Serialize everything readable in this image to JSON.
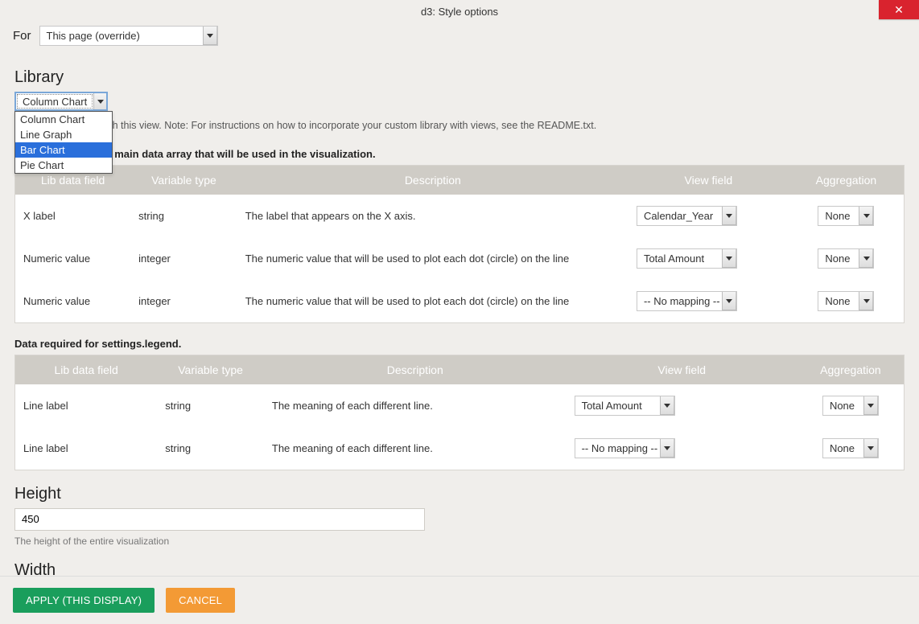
{
  "window_title": "d3: Style options",
  "for": {
    "label": "For",
    "value": "This page (override)"
  },
  "library": {
    "section_label": "Library",
    "selected": "Column Chart",
    "options": [
      "Column Chart",
      "Line Graph",
      "Bar Chart",
      "Pie Chart"
    ],
    "highlighted_option_index": 2,
    "visible_help_fragment": "u would like to use with this view. Note: For instructions on how to incorporate your custom library with views, see the README.txt."
  },
  "rows_section": {
    "visible_heading_fragment": "gs.rows. This is the main data array that will be used in the visualization.",
    "headers": [
      "Lib data field",
      "Variable type",
      "Description",
      "View field",
      "Aggregation"
    ],
    "rows": [
      {
        "lib": "X label",
        "vartype": "string",
        "desc": "The label that appears on the X axis.",
        "view": "Calendar_Year",
        "agg": "None"
      },
      {
        "lib": "Numeric value",
        "vartype": "integer",
        "desc": "The numeric value that will be used to plot each dot (circle) on the line",
        "view": "Total Amount",
        "agg": "None"
      },
      {
        "lib": "Numeric value",
        "vartype": "integer",
        "desc": "The numeric value that will be used to plot each dot (circle) on the line",
        "view": "-- No mapping --",
        "agg": "None"
      }
    ]
  },
  "legend_section": {
    "heading": "Data required for settings.legend.",
    "headers": [
      "Lib data field",
      "Variable type",
      "Description",
      "View field",
      "Aggregation"
    ],
    "rows": [
      {
        "lib": "Line label",
        "vartype": "string",
        "desc": "The meaning of each different line.",
        "view": "Total Amount",
        "agg": "None"
      },
      {
        "lib": "Line label",
        "vartype": "string",
        "desc": "The meaning of each different line.",
        "view": "-- No mapping --",
        "agg": "None"
      }
    ]
  },
  "height": {
    "label": "Height",
    "value": "450",
    "help": "The height of the entire visualization"
  },
  "width": {
    "label": "Width"
  },
  "buttons": {
    "apply": "Apply (this display)",
    "cancel": "Cancel"
  }
}
